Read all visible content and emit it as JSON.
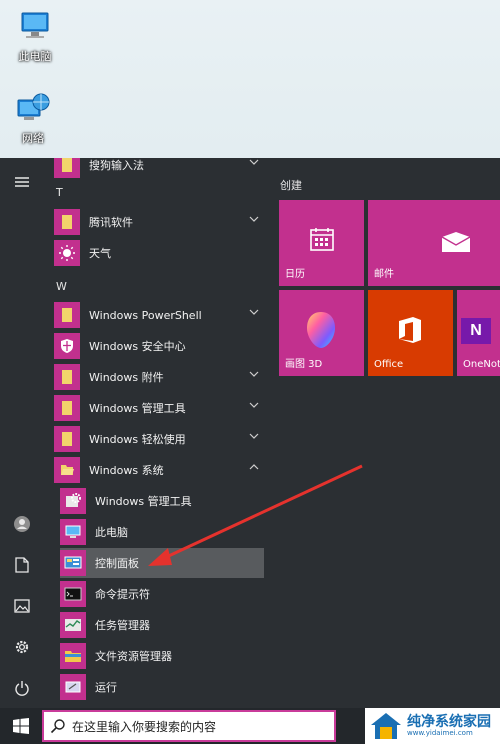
{
  "desktop": {
    "icons": [
      {
        "label": "此电脑",
        "icon": "computer-icon"
      },
      {
        "label": "网络",
        "icon": "network-icon"
      }
    ]
  },
  "start_menu": {
    "partial_top_item": "搜狗输入法",
    "letters": [
      "T",
      "W"
    ],
    "apps": [
      {
        "label": "腾讯软件",
        "icon": "folder-icon",
        "expandable": true
      },
      {
        "label": "天气",
        "icon": "weather-sun-icon",
        "expandable": false
      },
      {
        "label": "Windows PowerShell",
        "icon": "folder-icon",
        "expandable": true
      },
      {
        "label": "Windows 安全中心",
        "icon": "shield-icon",
        "expandable": false
      },
      {
        "label": "Windows 附件",
        "icon": "folder-icon",
        "expandable": true
      },
      {
        "label": "Windows 管理工具",
        "icon": "folder-icon",
        "expandable": true
      },
      {
        "label": "Windows 轻松使用",
        "icon": "folder-icon",
        "expandable": true
      },
      {
        "label": "Windows 系统",
        "icon": "folder-open-icon",
        "expandable": true,
        "expanded": true
      }
    ],
    "sub_apps": [
      {
        "label": "Windows 管理工具",
        "icon": "admin-tools-icon"
      },
      {
        "label": "此电脑",
        "icon": "computer-icon"
      },
      {
        "label": "控制面板",
        "icon": "control-panel-icon",
        "selected": true
      },
      {
        "label": "命令提示符",
        "icon": "cmd-icon"
      },
      {
        "label": "任务管理器",
        "icon": "task-manager-icon"
      },
      {
        "label": "文件资源管理器",
        "icon": "file-explorer-icon"
      },
      {
        "label": "运行",
        "icon": "run-icon"
      }
    ],
    "tiles_group": "创建",
    "tiles": [
      {
        "label": "日历",
        "icon": "calendar-icon",
        "color": "#c2308e"
      },
      {
        "label": "邮件",
        "icon": "mail-icon",
        "color": "#c2308e"
      },
      {
        "label": "画图 3D",
        "icon": "paint3d-icon",
        "color": "#c2308e"
      },
      {
        "label": "Office",
        "icon": "office-icon",
        "color": "#d83b01"
      },
      {
        "label": "OneNot",
        "icon": "onenote-icon",
        "color": "#c2308e"
      }
    ],
    "rail": [
      "user-icon",
      "document-icon",
      "pictures-icon",
      "settings-icon",
      "power-icon"
    ]
  },
  "taskbar": {
    "search_placeholder": "在这里输入你要搜索的内容",
    "watermark_name": "纯净系统家园",
    "watermark_url": "www.yidaimei.com"
  },
  "colors": {
    "accent": "#c2308e",
    "office": "#d83b01",
    "start_bg": "#2b2f33",
    "arrow": "#e5322d"
  }
}
